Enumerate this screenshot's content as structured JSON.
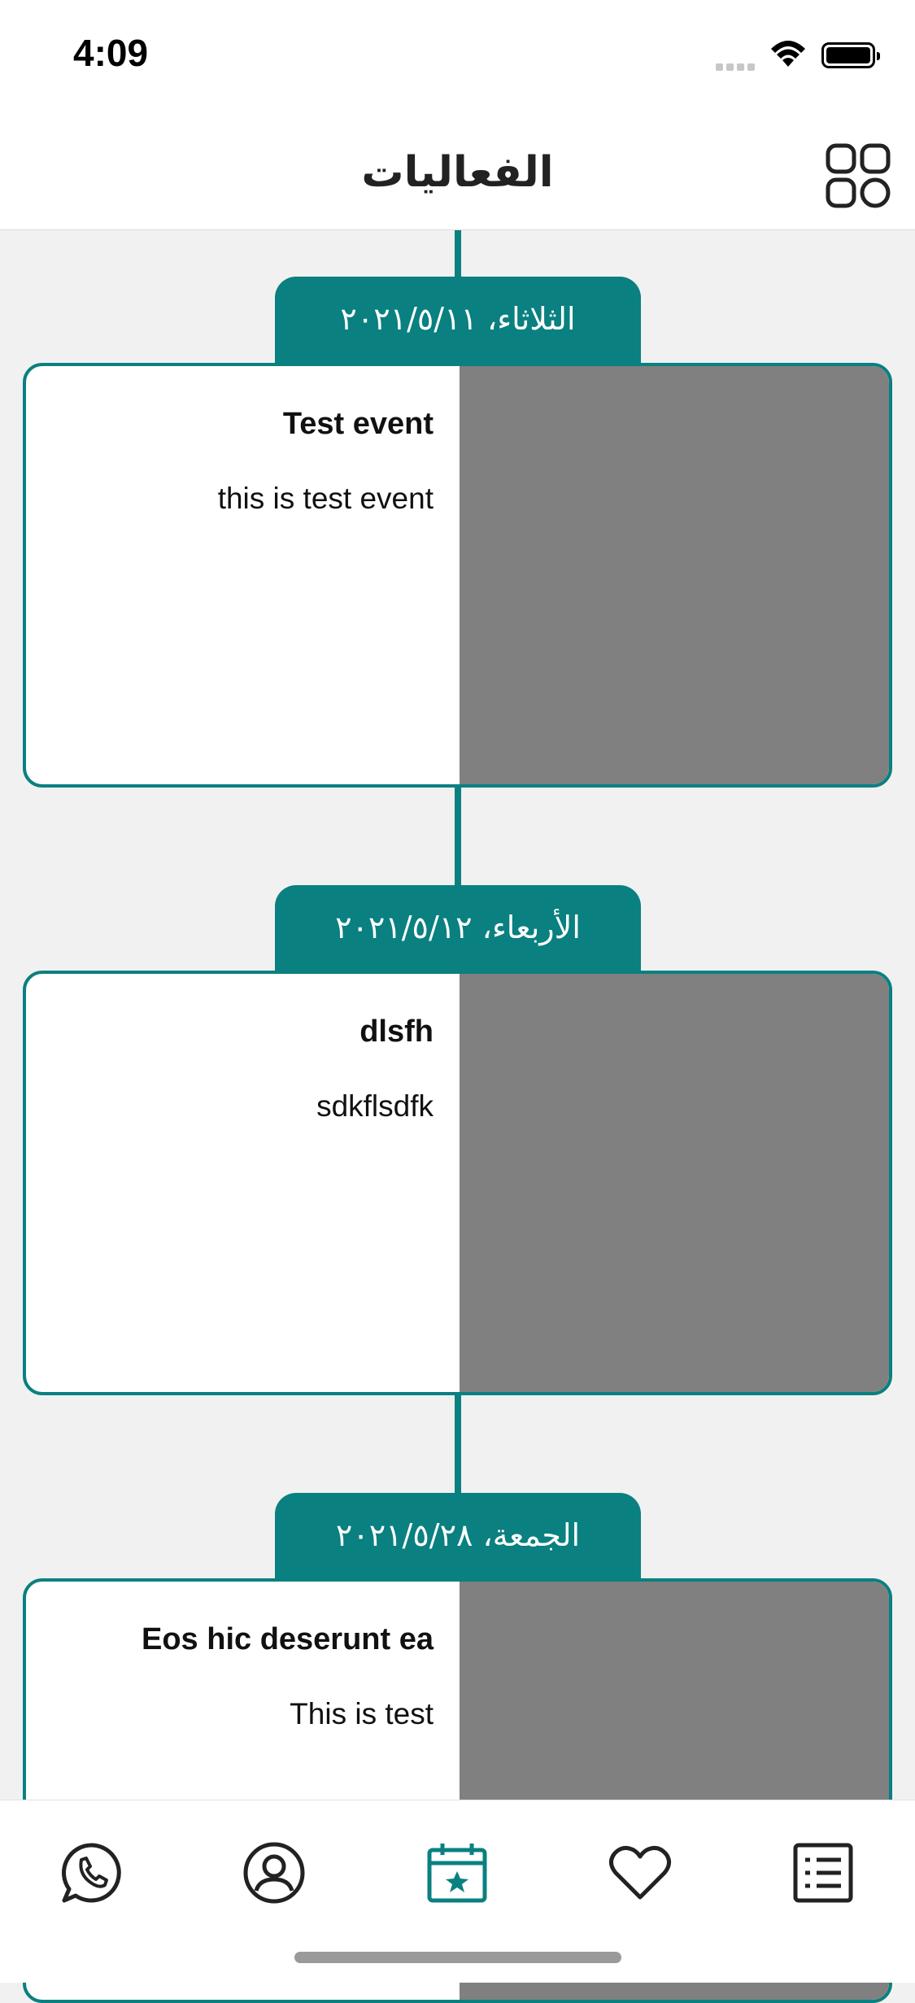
{
  "status_bar": {
    "time": "4:09"
  },
  "header": {
    "title": "الفعاليات",
    "grid_icon": "grid-icon"
  },
  "events": [
    {
      "date": "الثلاثاء، ٢٠٢١/٥/١١",
      "title": "Test event",
      "description": "this is test event"
    },
    {
      "date": "الأربعاء، ٢٠٢١/٥/١٢",
      "title": "dlsfh",
      "description": "sdkflsdfk"
    },
    {
      "date": "الجمعة، ٢٠٢١/٥/٢٨",
      "title": "Eos hic deserunt ea",
      "description": "This is test"
    }
  ],
  "tab_bar": {
    "items": [
      {
        "icon": "whatsapp-icon",
        "active": false
      },
      {
        "icon": "profile-icon",
        "active": false
      },
      {
        "icon": "calendar-star-icon",
        "active": true
      },
      {
        "icon": "heart-icon",
        "active": false
      },
      {
        "icon": "list-icon",
        "active": false
      }
    ]
  },
  "colors": {
    "accent": "#0a8080",
    "image_placeholder": "#808080",
    "background": "#f1f1f1"
  }
}
